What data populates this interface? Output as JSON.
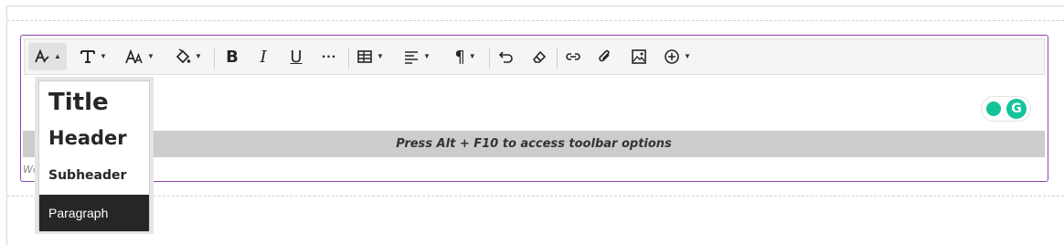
{
  "toolbar": {
    "text_style_label": "Text style",
    "font_label": "Font",
    "font_size_label": "Font size",
    "text_color_label": "Text color",
    "bold_label": "B",
    "italic_label": "I",
    "underline_label": "U",
    "more_label": "...",
    "table_label": "Table",
    "align_label": "Align",
    "paragraph_label": "Paragraph",
    "undo_label": "Undo",
    "clear_label": "Clear formatting",
    "link_label": "Link",
    "attach_label": "Attach",
    "image_label": "Image",
    "insert_label": "Insert"
  },
  "hint": {
    "text": "Press Alt + F10 to access toolbar options"
  },
  "wordcount": {
    "text": "Wo"
  },
  "grammarly": {
    "logo_letter": "G"
  },
  "dropdown": {
    "items": [
      {
        "label": "Title"
      },
      {
        "label": "Header"
      },
      {
        "label": "Subheader"
      },
      {
        "label": "Paragraph"
      }
    ],
    "selected": "Paragraph"
  },
  "colors": {
    "editor_border": "#8e44ad",
    "grammarly": "#15c39a",
    "hint_bar": "#cccccc",
    "selected_item": "#262626"
  }
}
